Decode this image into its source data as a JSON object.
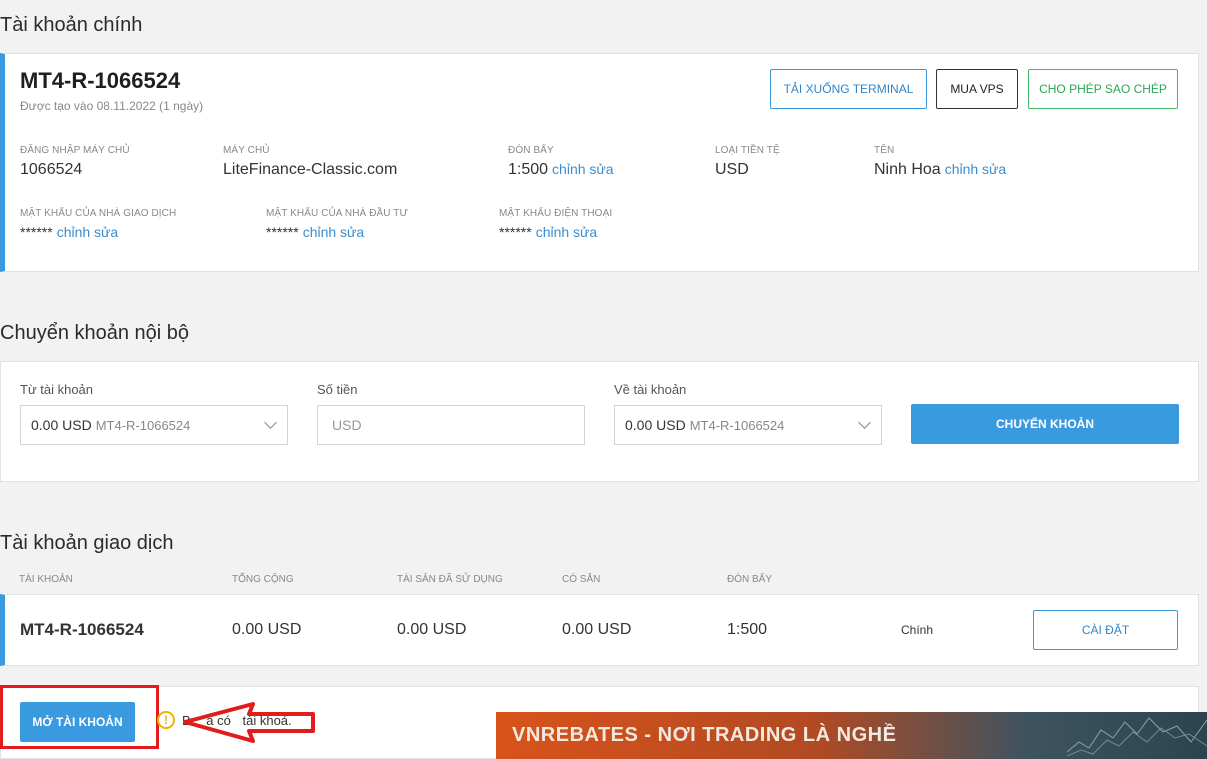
{
  "main_account": {
    "section_title": "Tài khoản chính",
    "account_id": "MT4-R-1066524",
    "created": "Được tạo vào 08.11.2022 (1 ngày)",
    "buttons": {
      "download_terminal": "TẢI XUỐNG TERMINAL",
      "buy_vps": "MUA VPS",
      "allow_copy": "CHO PHÉP SAO CHÉP"
    },
    "fields": {
      "server_login_label": "ĐĂNG NHẬP MÁY CHỦ",
      "server_login_value": "1066524",
      "server_label": "MÁY CHỦ",
      "server_value": "LiteFinance-Classic.com",
      "leverage_label": "ĐÒN BẨY",
      "leverage_value": "1:500",
      "currency_label": "LOẠI TIỀN TỆ",
      "currency_value": "USD",
      "name_label": "TÊN",
      "name_value": "Ninh Hoa",
      "trader_pw_label": "MẬT KHẨU CỦA NHÀ GIAO DỊCH",
      "trader_pw_value": "******",
      "investor_pw_label": "MẬT KHẨU CỦA NHÀ ĐẦU TƯ",
      "investor_pw_value": "******",
      "phone_pw_label": "MẬT KHẨU ĐIỆN THOẠI",
      "phone_pw_value": "******",
      "edit_label": "chỉnh sửa"
    }
  },
  "transfer": {
    "section_title": "Chuyển khoản nội bộ",
    "from_label": "Từ tài khoản",
    "from_amount": "0.00 USD",
    "from_account": "MT4-R-1066524",
    "amount_label": "Số tiền",
    "amount_placeholder": "USD",
    "to_label": "Về tài khoản",
    "to_amount": "0.00 USD",
    "to_account": "MT4-R-1066524",
    "submit_label": "CHUYỂN KHOẢN"
  },
  "trading": {
    "section_title": "Tài khoản giao dịch",
    "columns": [
      "TÀI KHOẢN",
      "TỔNG CỘNG",
      "TÀI SẢN ĐÃ SỬ DỤNG",
      "CÓ SẴN",
      "ĐÒN BẨY"
    ],
    "row": {
      "account": "MT4-R-1066524",
      "total": "0.00 USD",
      "used": "0.00 USD",
      "available": "0.00 USD",
      "leverage": "1:500",
      "type": "Chính",
      "settings_label": "CÀI ĐẶT"
    },
    "open_account_label": "MỞ TÀI KHOẢN",
    "notice_fragments": [
      "B",
      "a có",
      "tài khoả",
      "."
    ]
  },
  "banner": {
    "text": "VNREBATES - NƠI TRADING LÀ NGHỀ"
  },
  "colors": {
    "accent": "#3a9ae0",
    "annotation_red": "#e21b1b",
    "warning": "#f0b400"
  },
  "icons": [
    "chevron-down-icon",
    "warning-icon",
    "arrow-annotation-icon"
  ]
}
